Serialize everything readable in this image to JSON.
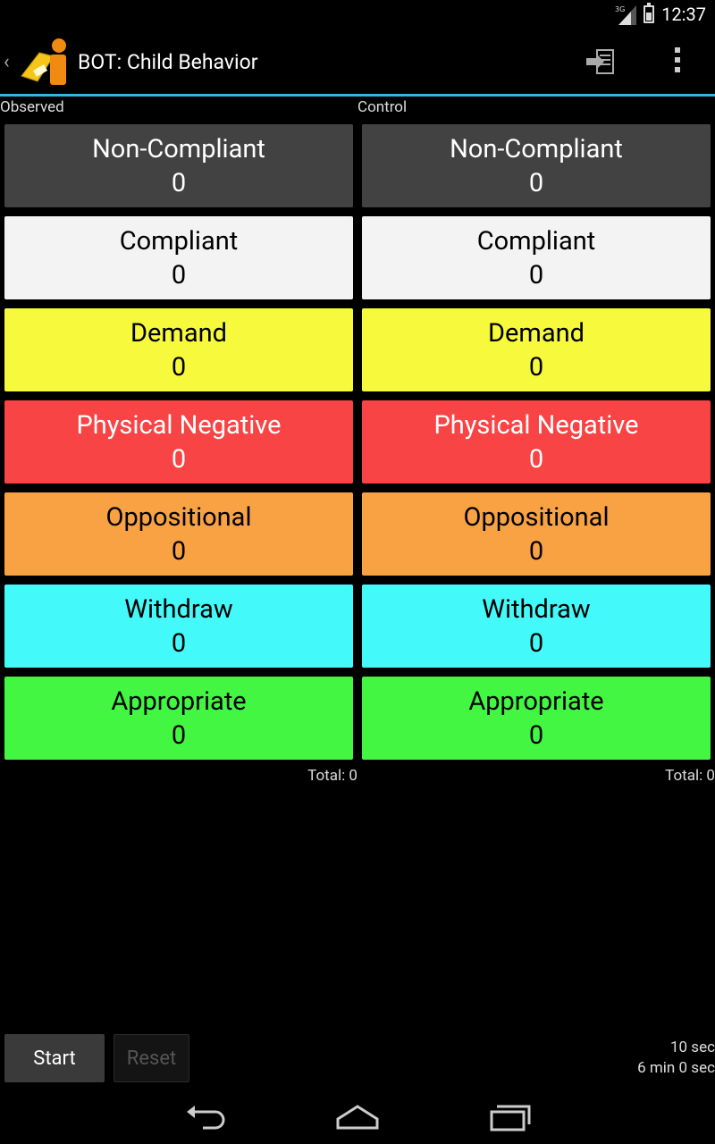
{
  "status": {
    "time": "12:37",
    "network": "3G"
  },
  "actionbar": {
    "title": "BOT: Child Behavior"
  },
  "columns": [
    {
      "label": "Observed",
      "total": "Total: 0",
      "buttons": [
        {
          "label": "Non-Compliant",
          "count": "0"
        },
        {
          "label": "Compliant",
          "count": "0"
        },
        {
          "label": "Demand",
          "count": "0"
        },
        {
          "label": "Physical Negative",
          "count": "0"
        },
        {
          "label": "Oppositional",
          "count": "0"
        },
        {
          "label": "Withdraw",
          "count": "0"
        },
        {
          "label": "Appropriate",
          "count": "0"
        }
      ]
    },
    {
      "label": "Control",
      "total": "Total: 0",
      "buttons": [
        {
          "label": "Non-Compliant",
          "count": "0"
        },
        {
          "label": "Compliant",
          "count": "0"
        },
        {
          "label": "Demand",
          "count": "0"
        },
        {
          "label": "Physical Negative",
          "count": "0"
        },
        {
          "label": "Oppositional",
          "count": "0"
        },
        {
          "label": "Withdraw",
          "count": "0"
        },
        {
          "label": "Appropriate",
          "count": "0"
        }
      ]
    }
  ],
  "colors": {
    "non_compliant": "#424242",
    "compliant": "#f3f3f3",
    "demand": "#f6f93c",
    "physical_negative": "#f84444",
    "oppositional": "#f8a243",
    "withdraw": "#43f9f9",
    "appropriate": "#42f642",
    "accent": "#33b5e5"
  },
  "controls": {
    "start_label": "Start",
    "reset_label": "Reset"
  },
  "timer": {
    "interval": "10 sec",
    "duration": "6 min 0 sec"
  },
  "icons": {
    "up": "chevron-left-icon",
    "app": "app-logo-icon",
    "export": "export-icon",
    "overflow": "overflow-menu-icon",
    "back": "back-icon",
    "home": "home-icon",
    "recents": "recents-icon"
  }
}
